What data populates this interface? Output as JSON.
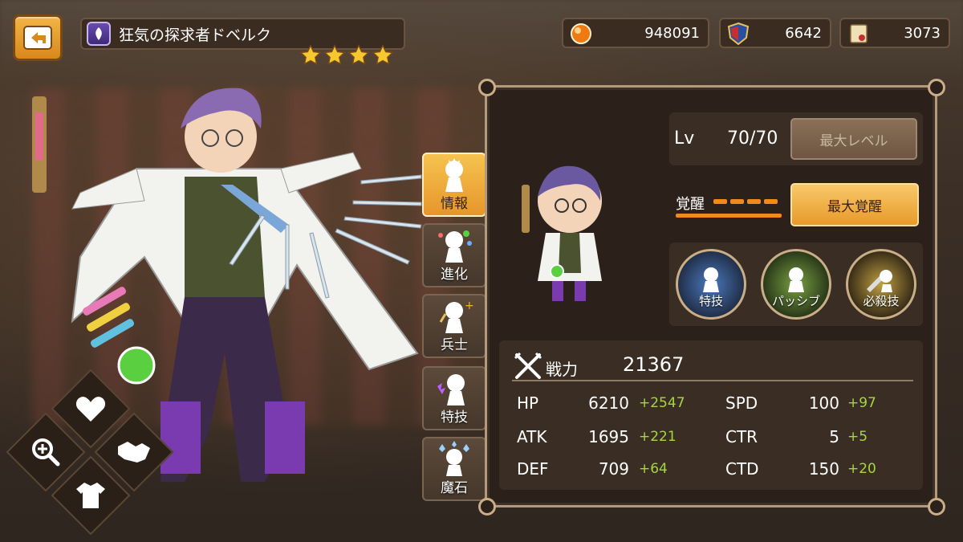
{
  "header": {
    "character_name": "狂気の探求者ドベルク",
    "stars": 4
  },
  "resources": [
    {
      "icon": "orange-gem-icon",
      "value": "948091"
    },
    {
      "icon": "crest-shield-icon",
      "value": "6642"
    },
    {
      "icon": "scroll-icon",
      "value": "3073"
    }
  ],
  "tabs": [
    {
      "label": "情報",
      "active": true
    },
    {
      "label": "進化",
      "active": false
    },
    {
      "label": "兵士",
      "active": false
    },
    {
      "label": "特技",
      "active": false
    },
    {
      "label": "魔石",
      "active": false
    }
  ],
  "level": {
    "label": "Lv",
    "value": "70/70",
    "button": "最大レベル"
  },
  "awaken": {
    "label": "覚醒",
    "button": "最大覚醒",
    "segments": 4
  },
  "skills": [
    {
      "label": "特技"
    },
    {
      "label": "パッシブ"
    },
    {
      "label": "必殺技"
    }
  ],
  "power": {
    "label": "戦力",
    "value": "21367"
  },
  "stats_left": [
    {
      "name": "HP",
      "value": "6210",
      "bonus": "+2547"
    },
    {
      "name": "ATK",
      "value": "1695",
      "bonus": "+221"
    },
    {
      "name": "DEF",
      "value": "709",
      "bonus": "+64"
    }
  ],
  "stats_right": [
    {
      "name": "SPD",
      "value": "100",
      "bonus": "+97"
    },
    {
      "name": "CTR",
      "value": "5",
      "bonus": "+5"
    },
    {
      "name": "CTD",
      "value": "150",
      "bonus": "+20"
    }
  ],
  "colors": {
    "accent_orange": "#e89a2a",
    "bonus_green": "#a6d640",
    "panel_bg": "#2b211a"
  }
}
